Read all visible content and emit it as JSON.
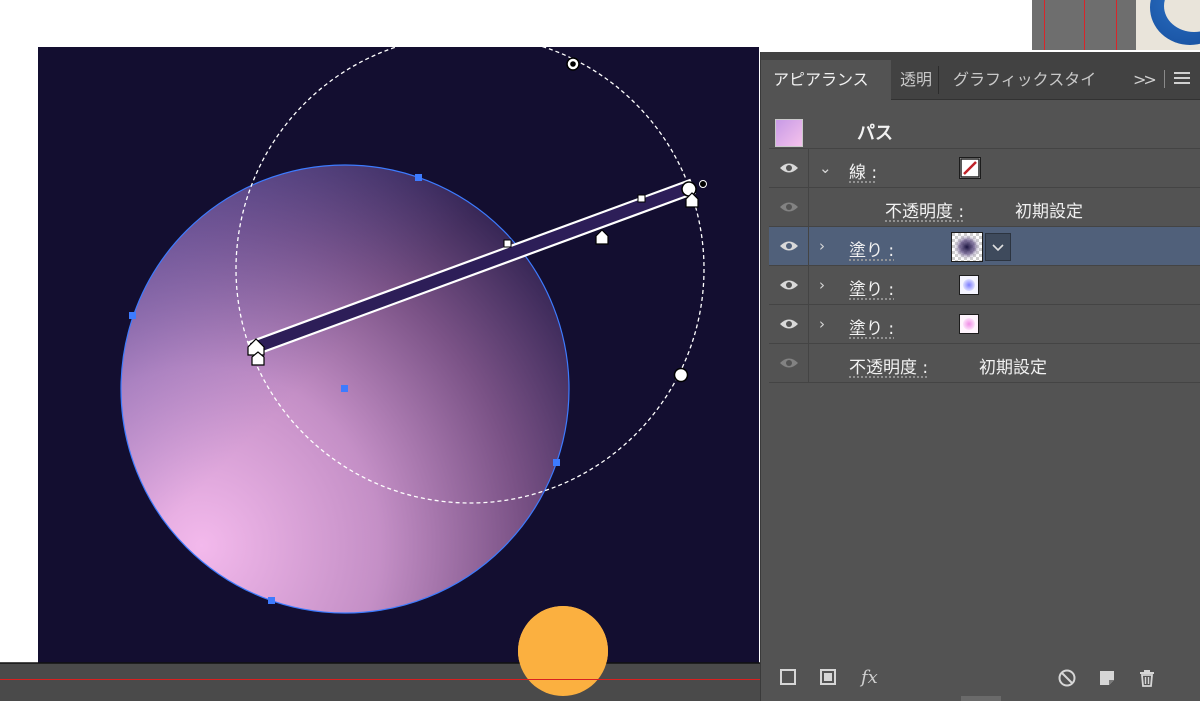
{
  "panel": {
    "tabs": [
      {
        "label": "アピアランス",
        "active": true
      },
      {
        "label": "透明",
        "active": false
      },
      {
        "label": "グラフィックスタイ",
        "active": false
      }
    ],
    "overflow_icon": "double-chevron-right-icon",
    "menu_icon": "hamburger-menu-icon",
    "title": "パス",
    "rows": [
      {
        "type": "stroke",
        "label": "線 :",
        "expanded": true,
        "visible": true
      },
      {
        "type": "opacity-sub",
        "label": "不透明度 :",
        "value": "初期設定",
        "visible": false
      },
      {
        "type": "fill",
        "label": "塗り :",
        "expanded": false,
        "visible": true,
        "selected": true
      },
      {
        "type": "fill",
        "label": "塗り :",
        "expanded": false,
        "visible": true
      },
      {
        "type": "fill",
        "label": "塗り :",
        "expanded": false,
        "visible": true
      },
      {
        "type": "opacity",
        "label": "不透明度 :",
        "value": "初期設定",
        "visible": false
      }
    ],
    "footer": {
      "fx_label": "fx",
      "icons": [
        "add-stroke-icon",
        "add-fill-icon",
        "fx-icon",
        "clear-appearance-icon",
        "duplicate-item-icon",
        "trash-icon"
      ]
    }
  },
  "colors": {
    "artboard_bg": "#130e30",
    "panel_bg": "#535353",
    "selected_row": "#50607a",
    "sphere_light": "#f3b9ec",
    "sphere_dark": "#241a48",
    "sun": "#fbb040",
    "selection_blue": "#3d7bff"
  }
}
